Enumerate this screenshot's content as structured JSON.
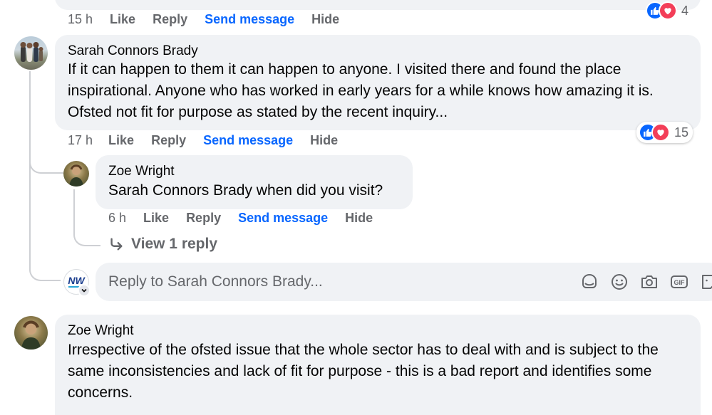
{
  "top_comment": {
    "time": "15 h",
    "like": "Like",
    "reply": "Reply",
    "send_message": "Send message",
    "hide": "Hide",
    "reaction_count": "4"
  },
  "comment_sarah": {
    "author": "Sarah Connors Brady",
    "text": "If it can happen to them it can happen to anyone. I visited there and found the place inspirational. Anyone who has worked in early years for a while knows how amazing it is. Ofsted not fit for purpose as stated by the recent inquiry...",
    "time": "17 h",
    "like": "Like",
    "reply": "Reply",
    "send_message": "Send message",
    "hide": "Hide",
    "reaction_count": "15"
  },
  "reply_zoe": {
    "author": "Zoe Wright",
    "mention": "Sarah Connors Brady",
    "text": " when did you visit?",
    "time": "6 h",
    "like": "Like",
    "reply": "Reply",
    "send_message": "Send message",
    "hide": "Hide"
  },
  "view_replies": "View 1 reply",
  "reply_box": {
    "avatar_text": "NW",
    "placeholder": "Reply to Sarah Connors Brady..."
  },
  "comment_zoe": {
    "author": "Zoe Wright",
    "text": "Irrespective of the ofsted issue that the whole sector has to deal with and is subject to the same inconsistencies and lack of fit for purpose - this is a bad report and identifies some concerns."
  },
  "colors": {
    "bubble": "#f0f2f5",
    "link_blue": "#0866ff",
    "secondary_text": "#65676b",
    "like_blue": "#0866ff",
    "love_red": "#f33e58"
  },
  "icons": [
    "like-reaction-icon",
    "love-reaction-icon",
    "reply-arrow-icon",
    "avatar-sticker-icon",
    "emoji-icon",
    "camera-icon",
    "gif-icon",
    "sticker-icon",
    "chevron-down-icon"
  ]
}
